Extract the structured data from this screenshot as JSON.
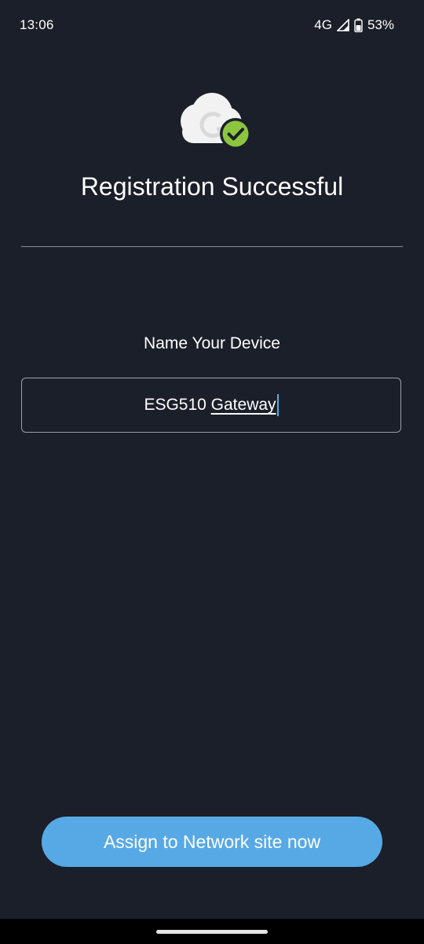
{
  "status_bar": {
    "time": "13:06",
    "network": "4G",
    "battery": "53%"
  },
  "logo": {
    "icon": "cloud-check-logo-icon",
    "cloud_color": "#f2f2f2",
    "check_color": "#8cc63f"
  },
  "title": "Registration Successful",
  "device_name": {
    "label": "Name Your Device",
    "value_part1": "ESG510",
    "value_part2": "Gateway"
  },
  "actions": {
    "assign_label": "Assign to Network site now"
  },
  "colors": {
    "background": "#1b1f29",
    "accent": "#57a9e6"
  }
}
